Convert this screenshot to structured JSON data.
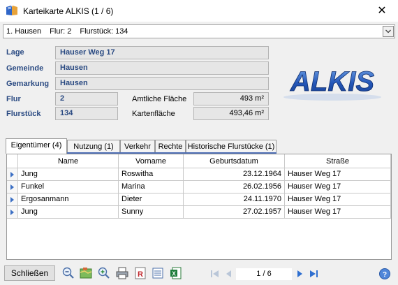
{
  "window": {
    "title": "Karteikarte ALKIS  (1 / 6)",
    "close_glyph": "✕"
  },
  "selector": {
    "index": "1. Hausen",
    "flur": "Flur: 2",
    "flurstueck": "Flurstück: 134"
  },
  "fields": {
    "lage_label": "Lage",
    "lage_value": "Hauser Weg 17",
    "gemeinde_label": "Gemeinde",
    "gemeinde_value": "Hausen",
    "gemarkung_label": "Gemarkung",
    "gemarkung_value": "Hausen",
    "flur_label": "Flur",
    "flur_value": "2",
    "flurstueck_label": "Flurstück",
    "flurstueck_value": "134",
    "amtliche_label": "Amtliche Fläche",
    "amtliche_value": "493 m²",
    "karten_label": "Kartenfläche",
    "karten_value": "493,46 m²"
  },
  "logo_text": "ALKIS",
  "tabs": [
    {
      "label": "Eigentümer (4)",
      "active": true
    },
    {
      "label": "Nutzung (1)",
      "active": false
    },
    {
      "label": "Verkehr",
      "active": false
    },
    {
      "label": "Rechte",
      "active": false
    },
    {
      "label": "Historische Flurstücke (1)",
      "active": false
    }
  ],
  "table": {
    "columns": [
      "Name",
      "Vorname",
      "Geburtsdatum",
      "Straße"
    ],
    "rows": [
      [
        "Jung",
        "Roswitha",
        "23.12.1964",
        "Hauser Weg 17"
      ],
      [
        "Funkel",
        "Marina",
        "26.02.1956",
        "Hauser Weg 17"
      ],
      [
        "Ergosanmann",
        "Dieter",
        "24.11.1970",
        "Hauser Weg 17"
      ],
      [
        "Jung",
        "Sunny",
        "27.02.1957",
        "Hauser Weg 17"
      ]
    ]
  },
  "footer": {
    "close_button": "Schließen",
    "pager": "1 / 6",
    "tools": [
      "zoom-out-icon",
      "map-icon",
      "zoom-in-icon",
      "print-icon",
      "report-icon",
      "list-icon",
      "excel-icon"
    ]
  },
  "colors": {
    "label_blue": "#2a4a82",
    "accent_blue": "#3b6fc4",
    "tab_underline": "#4f6fb5"
  }
}
